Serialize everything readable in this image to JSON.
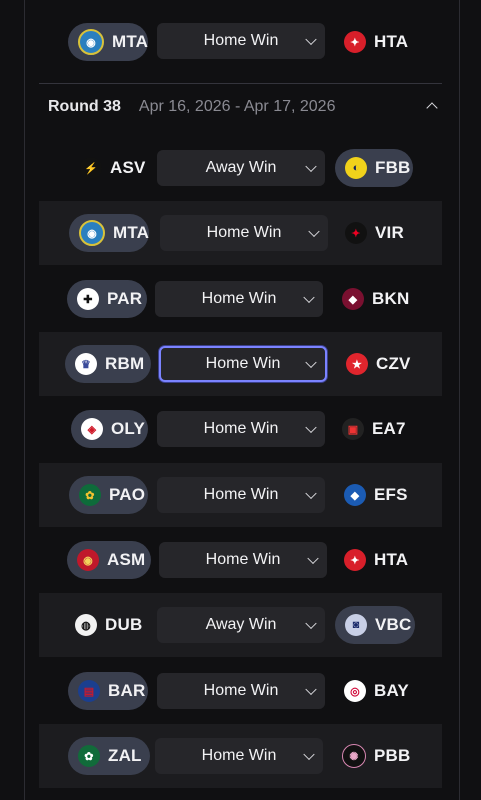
{
  "top_match": {
    "home": "MTA",
    "pick": "Home Win",
    "away": "HTA"
  },
  "round": {
    "title": "Round 38",
    "dates": "Apr 16, 2026 - Apr 17, 2026"
  },
  "matches": [
    {
      "home": "ASV",
      "pick": "Away Win",
      "away": "FBB"
    },
    {
      "home": "MTA",
      "pick": "Home Win",
      "away": "VIR"
    },
    {
      "home": "PAR",
      "pick": "Home Win",
      "away": "BKN"
    },
    {
      "home": "RBM",
      "pick": "Home Win",
      "away": "CZV"
    },
    {
      "home": "OLY",
      "pick": "Home Win",
      "away": "EA7"
    },
    {
      "home": "PAO",
      "pick": "Home Win",
      "away": "EFS"
    },
    {
      "home": "ASM",
      "pick": "Home Win",
      "away": "HTA"
    },
    {
      "home": "DUB",
      "pick": "Away Win",
      "away": "VBC"
    },
    {
      "home": "BAR",
      "pick": "Home Win",
      "away": "BAY"
    },
    {
      "home": "ZAL",
      "pick": "Home Win",
      "away": "PBB"
    }
  ],
  "logo_icons": {
    "MTA": "mta-logo-icon",
    "HTA": "hta-logo-icon",
    "ASV": "asv-logo-icon",
    "FBB": "fbb-logo-icon",
    "VIR": "vir-logo-icon",
    "PAR": "par-logo-icon",
    "BKN": "bkn-logo-icon",
    "RBM": "rbm-logo-icon",
    "CZV": "czv-logo-icon",
    "OLY": "oly-logo-icon",
    "EA7": "ea7-logo-icon",
    "PAO": "pao-logo-icon",
    "EFS": "efs-logo-icon",
    "ASM": "asm-logo-icon",
    "DUB": "dub-logo-icon",
    "VBC": "vbc-logo-icon",
    "BAR": "bar-logo-icon",
    "BAY": "bay-logo-icon",
    "ZAL": "zal-logo-icon",
    "PBB": "pbb-logo-icon"
  },
  "colors": {
    "background": "#101012",
    "row_shaded": "#1c1c1f",
    "pill": "#3a3f4e",
    "select": "#26262a",
    "focus_ring": "#7b83ff"
  }
}
